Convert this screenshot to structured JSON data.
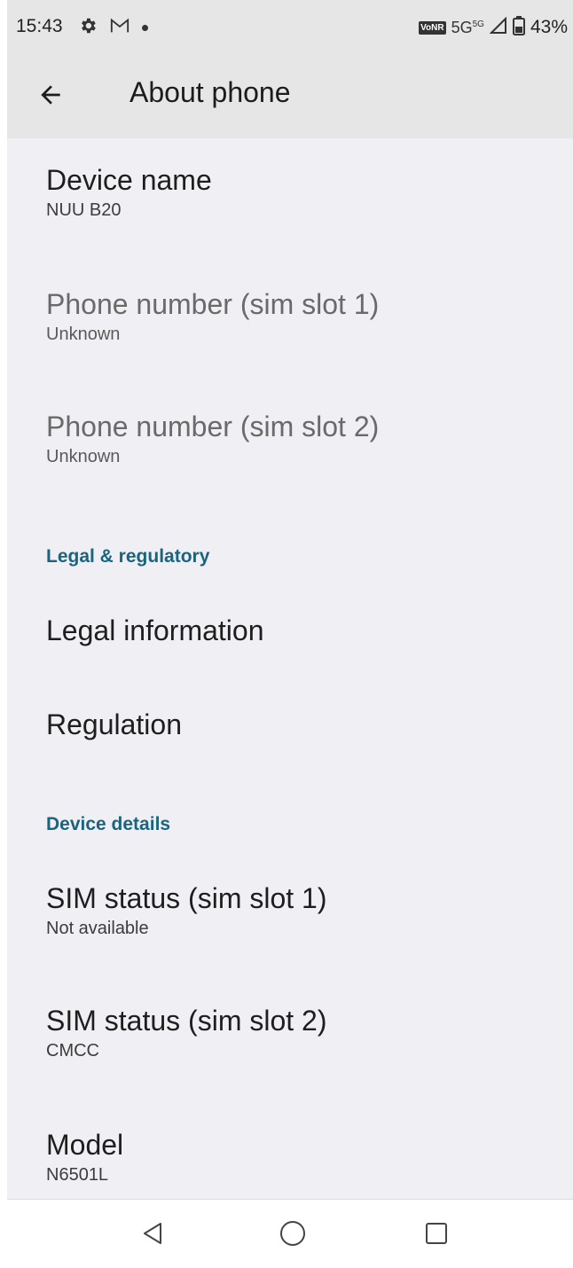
{
  "status_bar": {
    "time": "15:43",
    "icons": [
      "gear-icon",
      "gmail-icon",
      "notification-dot"
    ],
    "volte_label": "VoNR",
    "network_label": "5G",
    "network_sup": "5G",
    "battery_percent": "43%"
  },
  "app_bar": {
    "title": "About phone"
  },
  "preferences": {
    "device_name": {
      "title": "Device name",
      "summary": "NUU B20"
    },
    "phone_number_1": {
      "title": "Phone number (sim slot 1)",
      "summary": "Unknown"
    },
    "phone_number_2": {
      "title": "Phone number (sim slot 2)",
      "summary": "Unknown"
    },
    "legal_category": "Legal & regulatory",
    "legal_information": {
      "title": "Legal information"
    },
    "regulation": {
      "title": "Regulation"
    },
    "device_details_category": "Device details",
    "sim_status_1": {
      "title": "SIM status (sim slot 1)",
      "summary": "Not available"
    },
    "sim_status_2": {
      "title": "SIM status (sim slot 2)",
      "summary": "CMCC"
    },
    "model": {
      "title": "Model",
      "summary": "N6501L"
    }
  },
  "colors": {
    "accent": "#1a6480",
    "header_bg": "#e6e6e6",
    "content_bg": "#f0f0f4"
  },
  "nav_bar": {
    "icons": [
      "back-triangle-icon",
      "home-circle-icon",
      "recents-square-icon"
    ]
  }
}
